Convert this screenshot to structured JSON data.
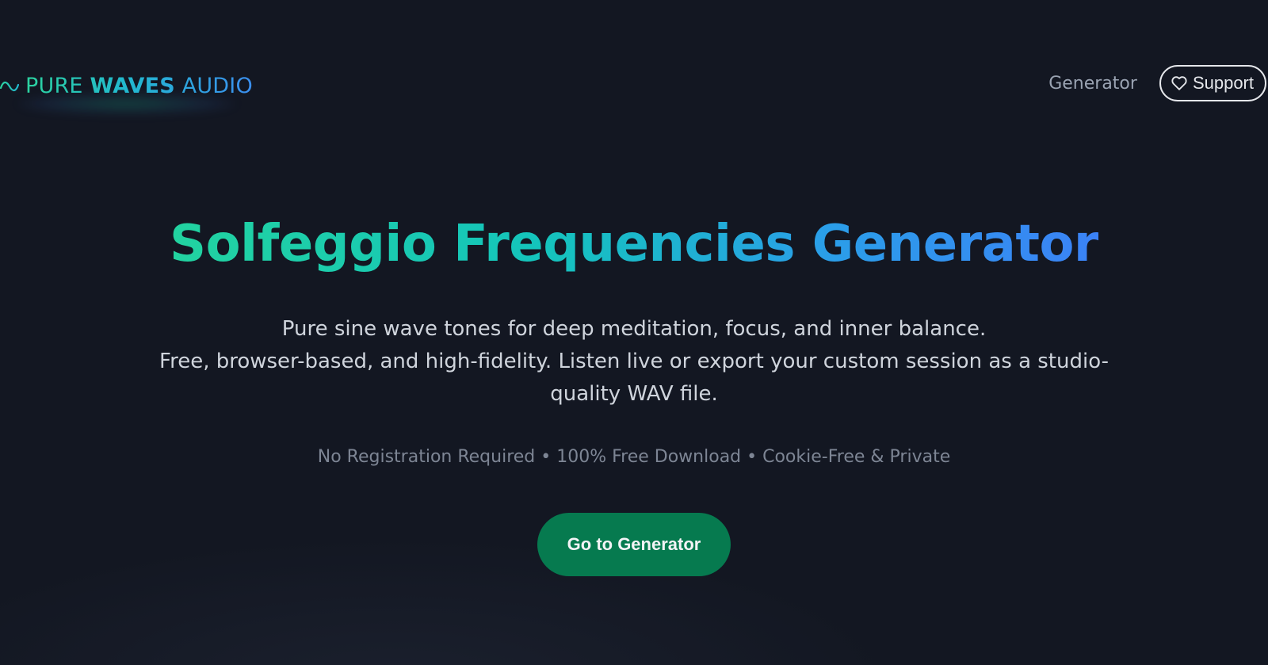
{
  "header": {
    "logo": {
      "icon": "sine-wave-icon",
      "part1": "PURE ",
      "part2": "WAVES",
      "part3": " AUDIO"
    },
    "nav": {
      "generator_label": "Generator",
      "support_label": "Support",
      "support_icon": "heart-icon"
    }
  },
  "hero": {
    "title": "Solfeggio Frequencies Generator",
    "subtitle_line1": "Pure sine wave tones for deep meditation, focus, and inner balance.",
    "subtitle_line2": "Free, browser-based, and high-fidelity. Listen live or export your custom session as a studio-quality WAV file.",
    "features": "No Registration Required • 100% Free Download • Cookie-Free & Private",
    "cta_label": "Go to Generator"
  },
  "colors": {
    "background": "#131722",
    "accent_green": "#22d3a0",
    "accent_blue": "#3b82f6",
    "cta_background": "#067a4f"
  }
}
